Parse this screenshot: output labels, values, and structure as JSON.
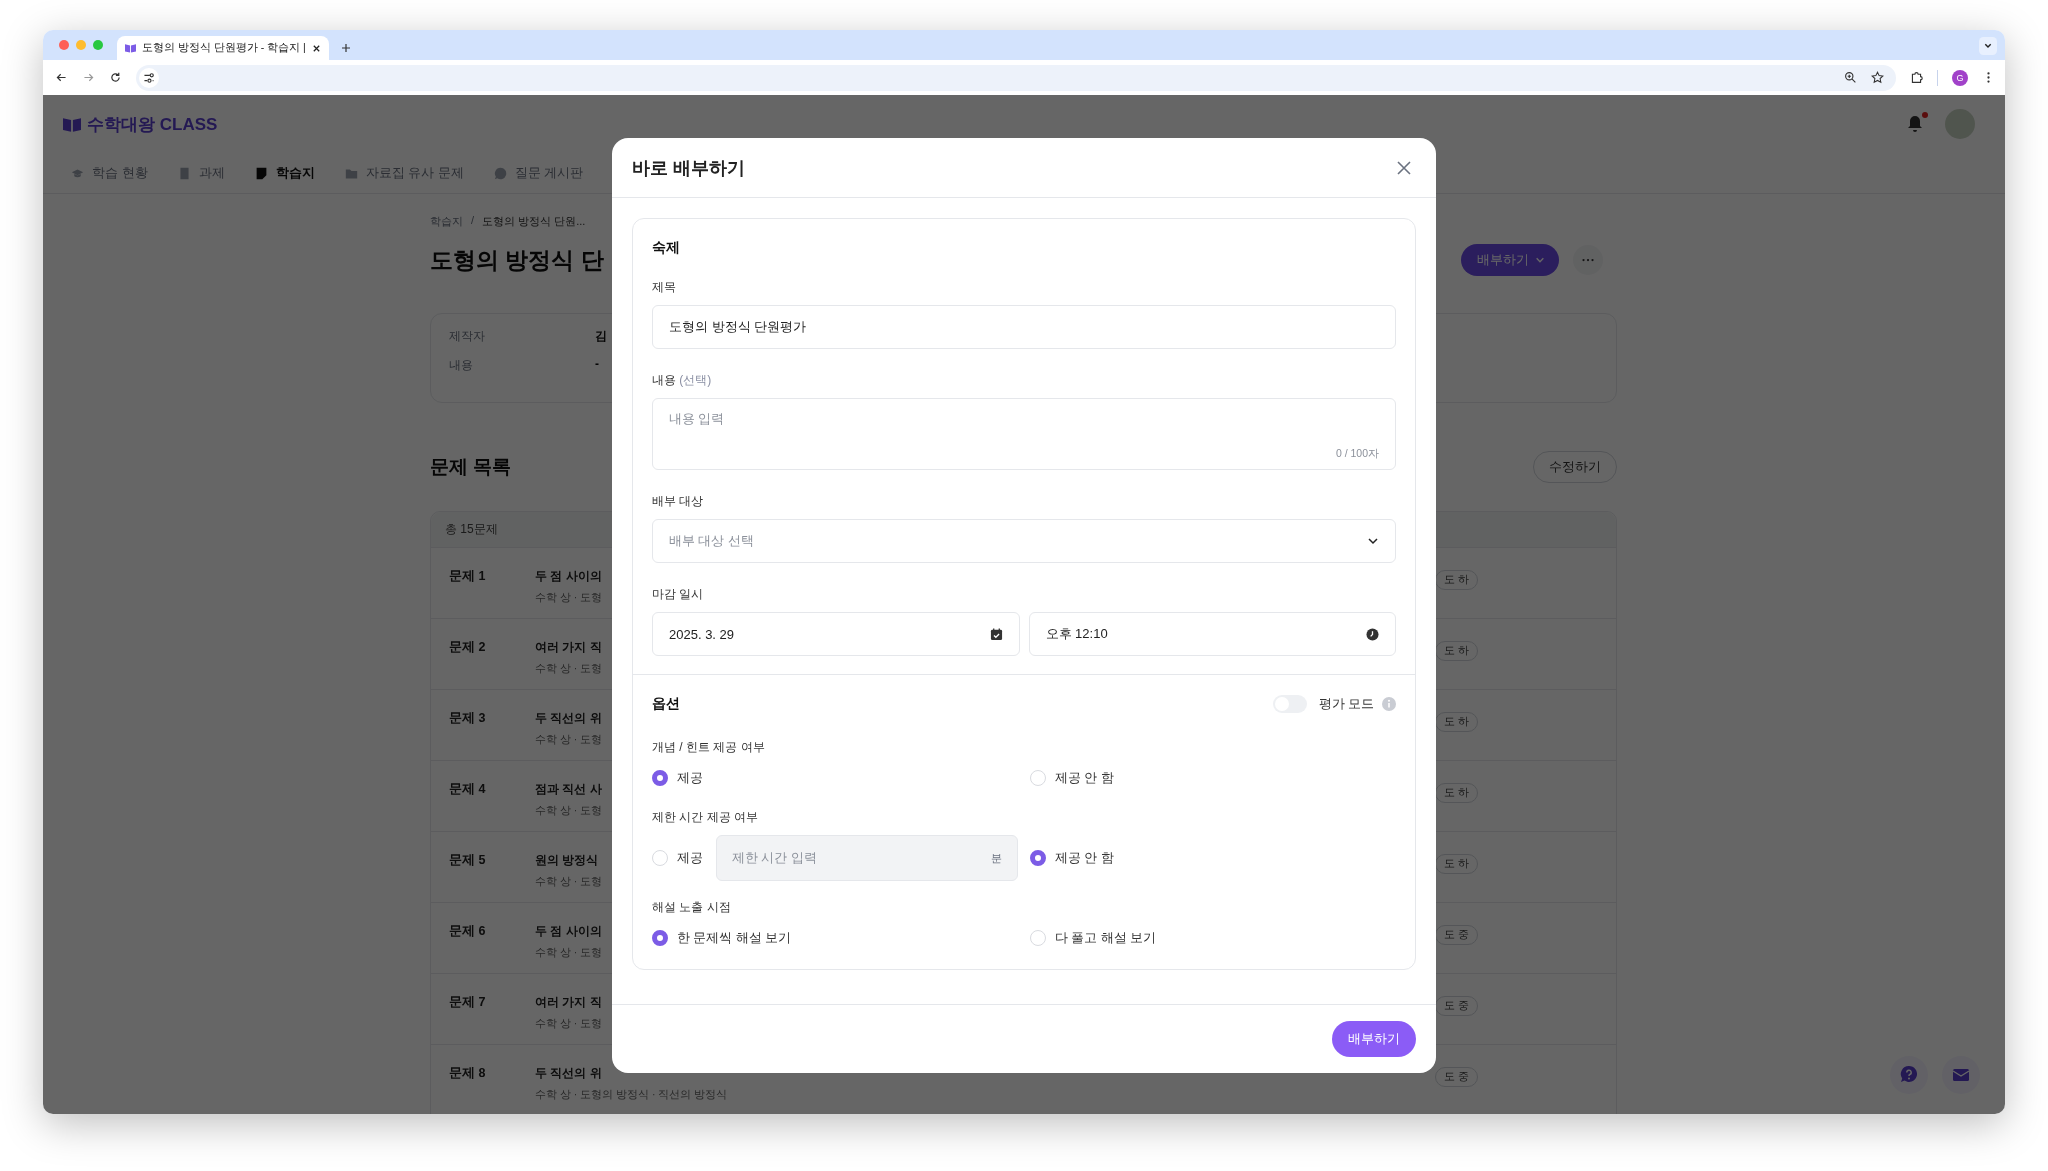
{
  "browser": {
    "tab_title": "도형의 방정식 단원평가 - 학습지 |",
    "profile_initial": "G"
  },
  "app": {
    "logo": "수학대왕 CLASS",
    "notification_unread": true,
    "nav": [
      {
        "label": "학습 현황",
        "selected": false,
        "kind": "cap"
      },
      {
        "label": "과제",
        "selected": false,
        "kind": "doc"
      },
      {
        "label": "학습지",
        "selected": true,
        "kind": "sheet"
      },
      {
        "label": "자료집 유사 문제",
        "selected": false,
        "kind": "folder"
      },
      {
        "label": "질문 게시판",
        "selected": false,
        "kind": "chat"
      }
    ]
  },
  "page": {
    "breadcrumb": {
      "root": "학습지",
      "separator": "/",
      "current": "도형의 방정식 단원..."
    },
    "title": "도형의 방정식 단",
    "distribute_button": "배부하기",
    "info": [
      {
        "label": "제작자",
        "value": "김"
      },
      {
        "label": "내용",
        "value": "-"
      }
    ],
    "section_title": "문제 목록",
    "edit_button": "수정하기",
    "total": "총 15문제",
    "problems": [
      {
        "number": "문제 1",
        "title": "두 점 사이의",
        "meta": "수학 상 · 도형",
        "difficulty": "도 하"
      },
      {
        "number": "문제 2",
        "title": "여러 가지 직",
        "meta": "수학 상 · 도형",
        "difficulty": "도 하"
      },
      {
        "number": "문제 3",
        "title": "두 직선의 위",
        "meta": "수학 상 · 도형",
        "difficulty": "도 하"
      },
      {
        "number": "문제 4",
        "title": "점과 직선 사",
        "meta": "수학 상 · 도형",
        "difficulty": "도 하"
      },
      {
        "number": "문제 5",
        "title": "원의 방정식",
        "meta": "수학 상 · 도형",
        "difficulty": "도 하"
      },
      {
        "number": "문제 6",
        "title": "두 점 사이의",
        "meta": "수학 상 · 도형",
        "difficulty": "도 중"
      },
      {
        "number": "문제 7",
        "title": "여러 가지 직",
        "meta": "수학 상 · 도형",
        "difficulty": "도 중"
      },
      {
        "number": "문제 8",
        "title": "두 직선의 위",
        "meta": "수학 상 · 도형의 방정식 · 직선의 방정식",
        "difficulty": "도 중"
      }
    ]
  },
  "modal": {
    "title": "바로 배부하기",
    "homework": {
      "heading": "숙제",
      "title_label": "제목",
      "title_value": "도형의 방정식 단원평가",
      "content_label": "내용",
      "content_optional": "(선택)",
      "content_placeholder": "내용 입력",
      "char_count": "0 / 100자",
      "target_label": "배부 대상",
      "target_placeholder": "배부 대상 선택",
      "deadline_label": "마감 일시",
      "date": "2025. 3. 29",
      "time": "오후 12:10"
    },
    "options": {
      "heading": "옵션",
      "eval_mode": {
        "label": "평가 모드",
        "on": false
      },
      "groups": [
        {
          "label": "개념 / 힌트 제공 여부",
          "choices": [
            {
              "label": "제공",
              "selected": true,
              "kind": "plain"
            },
            {
              "label": "제공 안 함",
              "selected": false,
              "kind": "plain"
            }
          ]
        },
        {
          "label": "제한 시간 제공 여부",
          "choices": [
            {
              "label": "제공",
              "selected": false,
              "kind": "with-input",
              "placeholder": "제한 시간 입력",
              "unit": "분"
            },
            {
              "label": "제공 안 함",
              "selected": true,
              "kind": "plain"
            }
          ]
        },
        {
          "label": "해설 노출 시점",
          "choices": [
            {
              "label": "한 문제씩 해설 보기",
              "selected": true,
              "kind": "plain"
            },
            {
              "label": "다 풀고 해설 보기",
              "selected": false,
              "kind": "plain"
            }
          ]
        }
      ]
    },
    "submit": "배부하기"
  }
}
